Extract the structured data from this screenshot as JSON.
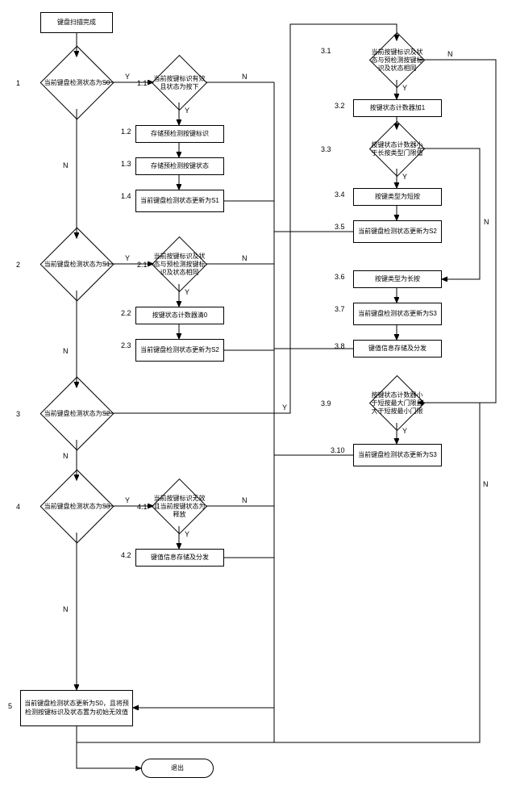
{
  "start": "键盘扫描完成",
  "end": "退出",
  "d1": "当前键盘检测状态为S0",
  "d1_1": "当前按键标识有效且状态为按下",
  "b1_2": "存储预检测按键标识",
  "b1_3": "存储预检测按键状态",
  "b1_4": "当前键盘检测状态更新为S1",
  "d2": "当前键盘检测状态为S1",
  "d2_1": "当前按键标识及状态与预检测按键标识及状态相同",
  "b2_2": "按键状态计数器清0",
  "b2_3": "当前键盘检测状态更新为S2",
  "d3": "当前键盘检测状态为S2",
  "d4": "当前键盘检测状态为S3",
  "d4_1": "当前按键标识无效且当前按键状态为释放",
  "b4_2": "键值信息存储及分发",
  "b5": "当前键盘检测状态更新为S0，且将预检测按键标识及状态置为初始无效值",
  "d3_1": "当前按键标识及状态与预检测按键标识及状态相同",
  "b3_2": "按键状态计数器加1",
  "d3_3": "按键状态计数器小于长按类型门限值",
  "b3_4": "按键类型为短按",
  "b3_5": "当前键盘检测状态更新为S2",
  "b3_6": "按键类型为长按",
  "b3_7": "当前键盘检测状态更新为S3",
  "b3_8": "键值信息存储及分发",
  "d3_9": "按键状态计数器小于短按最大门限且大于短按最小门限",
  "b3_10": "当前键盘检测状态更新为S3",
  "labels": {
    "n1": "1",
    "n1_1": "1.1",
    "n1_2": "1.2",
    "n1_3": "1.3",
    "n1_4": "1.4",
    "n2": "2",
    "n2_1": "2.1",
    "n2_2": "2.2",
    "n2_3": "2.3",
    "n3": "3",
    "n3_1": "3.1",
    "n3_2": "3.2",
    "n3_3": "3.3",
    "n3_4": "3.4",
    "n3_5": "3.5",
    "n3_6": "3.6",
    "n3_7": "3.7",
    "n3_8": "3.8",
    "n3_9": "3.9",
    "n3_10": "3.10",
    "n4": "4",
    "n4_1": "4.1",
    "n4_2": "4.2",
    "n5": "5",
    "Y": "Y",
    "N": "N"
  }
}
